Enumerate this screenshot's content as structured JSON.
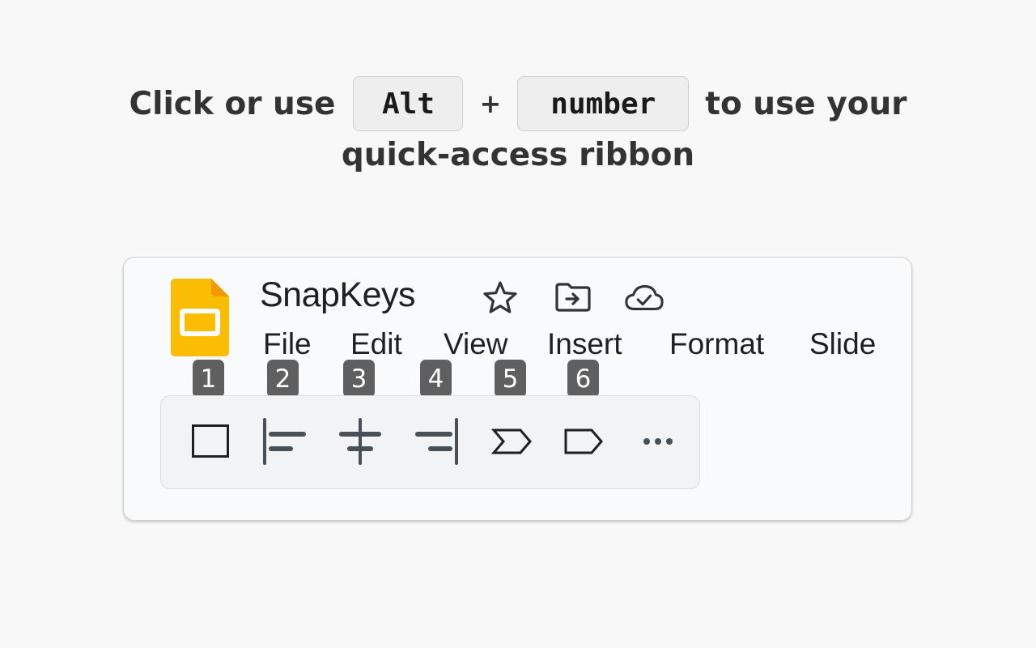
{
  "headline": {
    "prefix": "Click or use",
    "key1": "Alt",
    "plus": "+",
    "key2": "number",
    "suffix": "to use your",
    "line2": "quick-access ribbon"
  },
  "app": {
    "title": "SnapKeys",
    "logo_color": "#FBBC04",
    "title_icons": [
      "star-icon",
      "move-to-folder-icon",
      "cloud-saved-icon"
    ],
    "menu": [
      "File",
      "Edit",
      "View",
      "Insert",
      "Format",
      "Slide"
    ]
  },
  "ribbon": {
    "buttons": [
      {
        "badge": "1",
        "icon": "rectangle-shape-icon"
      },
      {
        "badge": "2",
        "icon": "align-left-icon"
      },
      {
        "badge": "3",
        "icon": "align-center-icon"
      },
      {
        "badge": "4",
        "icon": "align-right-icon"
      },
      {
        "badge": "5",
        "icon": "chevron-shape-icon"
      },
      {
        "badge": "6",
        "icon": "pentagon-shape-icon"
      },
      {
        "badge": "",
        "icon": "more-options-icon"
      }
    ]
  }
}
